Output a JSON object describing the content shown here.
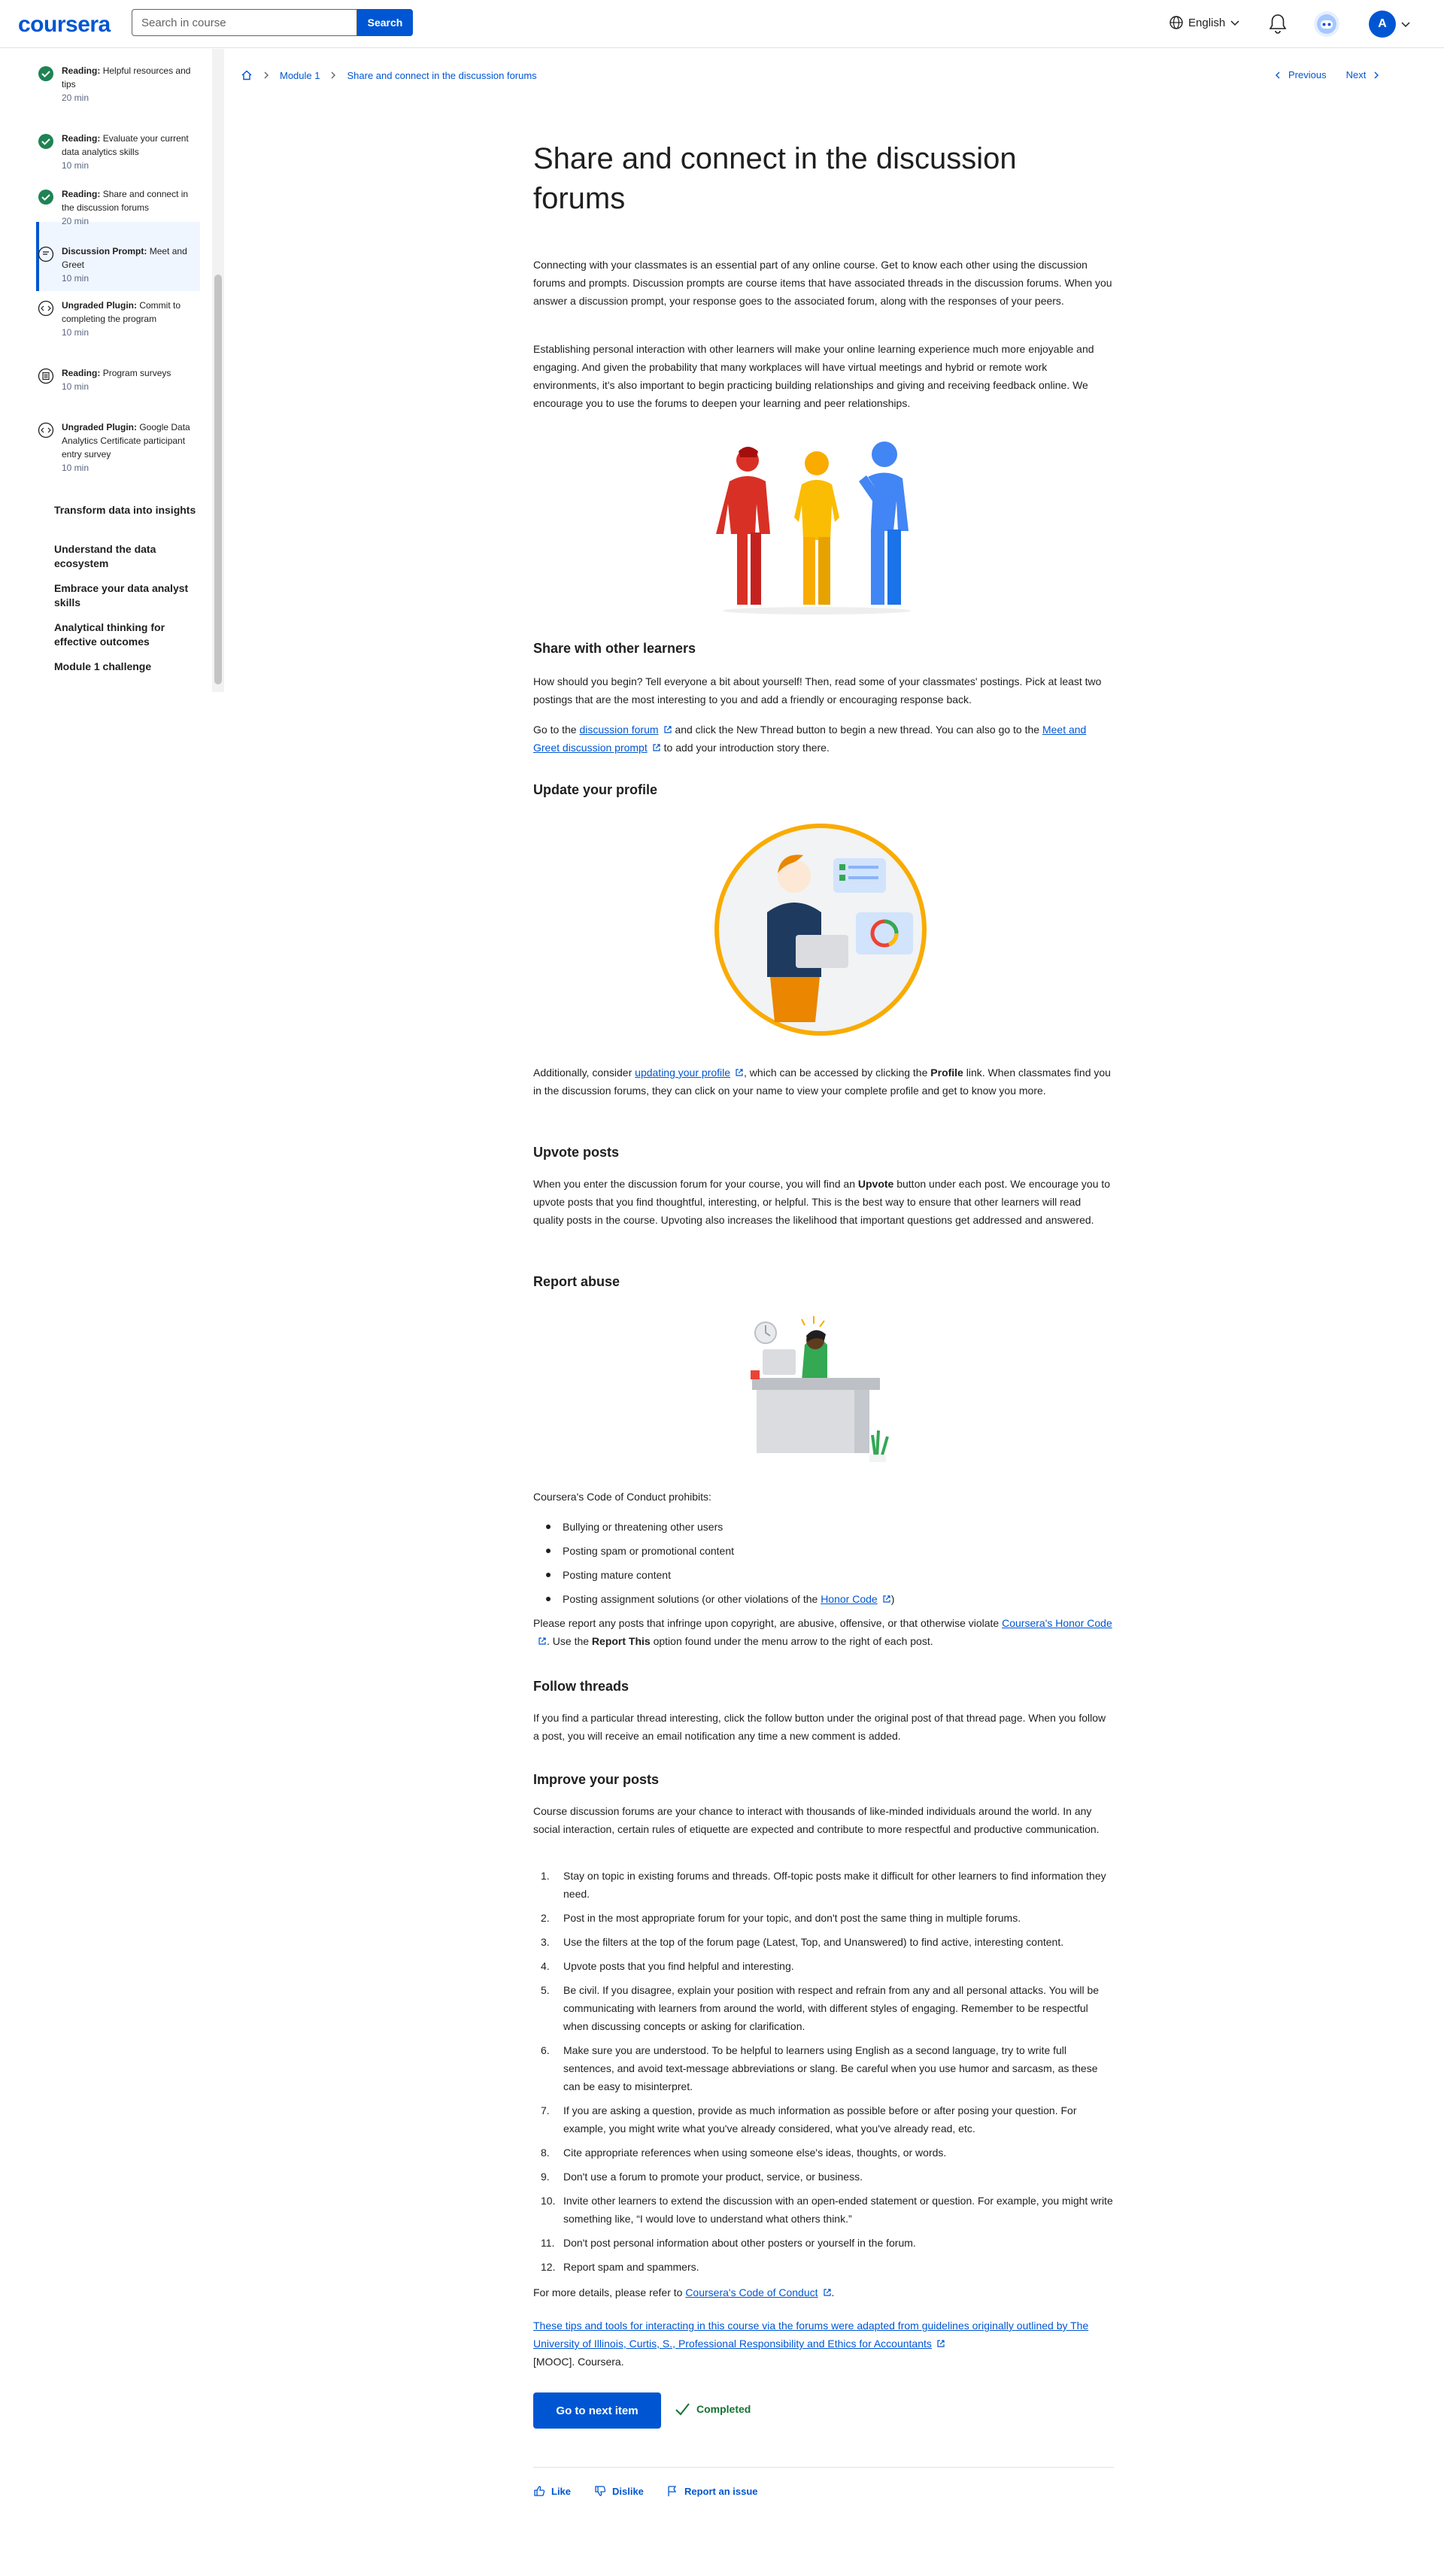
{
  "header": {
    "logo": "coursera",
    "search_placeholder": "Search in course",
    "search_button": "Search",
    "language": "English",
    "avatar_initial": "A"
  },
  "sidebar": {
    "items": [
      {
        "type": "Reading:",
        "label": "Helpful resources and tips",
        "duration": "20 min"
      },
      {
        "type": "Reading:",
        "label": "Evaluate your current data analytics skills",
        "duration": "10 min"
      },
      {
        "type": "Reading:",
        "label": "Share and connect in the discussion forums",
        "duration": "20 min"
      },
      {
        "type": "Discussion Prompt:",
        "label": "Meet and Greet",
        "duration": "10 min"
      },
      {
        "type": "Ungraded Plugin:",
        "label": "Commit to completing the program",
        "duration": "10 min"
      },
      {
        "type": "Reading:",
        "label": "Program surveys",
        "duration": "10 min"
      },
      {
        "type": "Ungraded Plugin:",
        "label": "Google Data Analytics Certificate participant entry survey",
        "duration": "10 min"
      }
    ],
    "modules": [
      "Transform data into insights",
      "Understand the data ecosystem",
      "Embrace your data analyst skills",
      "Analytical thinking for effective outcomes",
      "Module 1 challenge"
    ]
  },
  "breadcrumb": {
    "module": "Module 1",
    "page": "Share and connect in the discussion forums"
  },
  "nav": {
    "previous": "Previous",
    "next": "Next"
  },
  "article": {
    "title": "Share and connect in the discussion forums",
    "intro1": "Connecting with your classmates is an essential part of any online course. Get to know each other using the discussion forums and prompts. Discussion prompts are course items that have associated threads in the discussion forums. When you answer a discussion prompt, your response goes to the associated forum, along with the responses of your peers.",
    "intro2": "Establishing personal interaction with other learners will make your online learning experience much more enjoyable and engaging. And given the probability that many workplaces will have virtual meetings and hybrid or remote work environments, it's also important to begin practicing building relationships and giving and receiving feedback online. We encourage you to use the forums to deepen your learning and peer relationships.",
    "share_heading": "Share with other learners",
    "share_p1": "How should you begin? Tell everyone a bit about yourself! Then, read some of your classmates' postings. Pick at least two postings that are the most interesting to you and add a friendly or encouraging response back.",
    "share_p2_a": "Go to the ",
    "share_p2_link1": "discussion forum",
    "share_p2_b": " and click the New Thread button to begin a new thread. You can also go to the ",
    "share_p2_link2": "Meet and Greet discussion prompt",
    "share_p2_c": " to add your introduction story there.",
    "profile_heading": "Update your profile",
    "profile_p_a": "Additionally, consider ",
    "profile_p_link": "updating your profile",
    "profile_p_b": ", which can be accessed by clicking the ",
    "profile_p_bold": "Profile",
    "profile_p_c": " link. When classmates find you in the discussion forums, they can click on your name to view your complete profile and get to know you more.",
    "upvote_heading": "Upvote posts",
    "upvote_p_a": "When you enter the discussion forum for your course, you will find an ",
    "upvote_p_bold": "Upvote",
    "upvote_p_b": " button under each post. We encourage you to upvote posts that you find thoughtful, interesting, or helpful. This is the best way to ensure that other learners will read quality posts in the course. Upvoting also increases the likelihood that important questions get addressed and answered.",
    "report_heading": "Report abuse",
    "code_intro": "Coursera's Code of Conduct prohibits:",
    "prohibits": [
      "Bullying or threatening other users",
      "Posting spam or promotional content",
      "Posting mature content"
    ],
    "prohibit4_a": "Posting assignment solutions (or other violations of the ",
    "prohibit4_link": "Honor Code",
    "prohibit4_b": ")",
    "report_p_a": "Please report any posts that infringe upon copyright, are abusive, offensive, or that otherwise violate ",
    "report_p_link": "Coursera's Honor Code",
    "report_p_b": ". Use the ",
    "report_p_bold": "Report This",
    "report_p_c": " option found under the menu arrow to the right of each post.",
    "follow_heading": "Follow threads",
    "follow_p": "If you find a particular thread interesting, click the follow button under the original post of that thread page. When you follow a post, you will receive an email notification any time a new comment is added.",
    "improve_heading": "Improve your posts",
    "improve_p": "Course discussion forums are your chance to interact with thousands of like-minded individuals around the world. In any social interaction, certain rules of etiquette are expected and contribute to more respectful and productive communication.",
    "tips": [
      "Stay on topic in existing forums and threads. Off-topic posts make it difficult for other learners to find information they need.",
      "Post in the most appropriate forum for your topic, and don't post the same thing in multiple forums.",
      "Use the filters at the top of the forum page (Latest, Top, and Unanswered) to find active, interesting content.",
      "Upvote posts that you find helpful and interesting.",
      "Be civil. If you disagree, explain your position with respect and refrain from any and all personal attacks. You will be communicating with learners from around the world, with different styles of engaging. Remember to be respectful when discussing concepts or asking for clarification.",
      "Make sure you are understood. To be helpful to learners using English as a second language, try to write full sentences, and avoid text-message abbreviations or slang. Be careful when you use humor and sarcasm, as these can be easy to misinterpret.",
      "If you are asking a question, provide as much information as possible before or after posing your question. For example,  you might write what you've already considered, what you've already read, etc.",
      "Cite appropriate references when using someone else's ideas, thoughts, or words.",
      "Don't use a forum to promote your product, service, or business.",
      "Invite other learners to extend the discussion with an open-ended statement or question. For example, you might write something like, “I would love to understand what others think.”",
      "Don't post personal information about other posters or yourself in the forum.",
      "Report spam and spammers."
    ],
    "details_a": "For more details, please refer to ",
    "details_link": "Coursera's Code of Conduct",
    "details_b": ".",
    "source_link": "These tips and tools for interacting in this course via the forums were adapted from guidelines originally outlined by The University of Illinois, Curtis, S., Professional Responsibility and Ethics for Accountants",
    "source_tail": "[MOOC]. Coursera."
  },
  "footer": {
    "next_button": "Go to next item",
    "completed": "Completed",
    "like": "Like",
    "dislike": "Dislike",
    "report": "Report an issue"
  },
  "colors": {
    "brand": "#0056d2",
    "success": "#1f8354",
    "text": "#1f1f1f"
  }
}
